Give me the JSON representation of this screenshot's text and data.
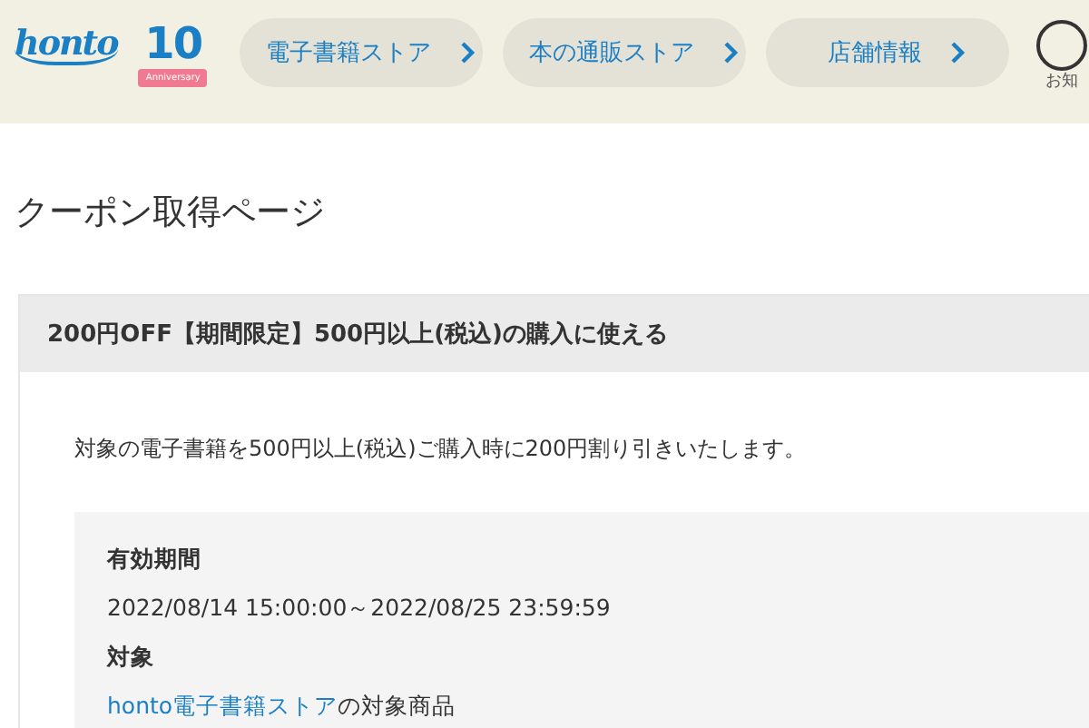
{
  "header": {
    "logo": "honto",
    "anniversary": {
      "number": "10",
      "ribbon": "Anniversary"
    },
    "nav": [
      {
        "label": "電子書籍ストア"
      },
      {
        "label": "本の通販ストア"
      },
      {
        "label": "店舗情報"
      }
    ],
    "notice": {
      "label": "お知"
    }
  },
  "page_title": "クーポン取得ページ",
  "coupon": {
    "title": "200円OFF【期間限定】500円以上(税込)の購入に使える",
    "description": "対象の電子書籍を500円以上(税込)ご購入時に200円割り引きいたします。",
    "details": [
      {
        "label": "有効期間",
        "value": "2022/08/14 15:00:00～2022/08/25 23:59:59"
      },
      {
        "label": "対象",
        "link": "honto電子書籍ストア",
        "value": "の対象商品"
      }
    ]
  }
}
